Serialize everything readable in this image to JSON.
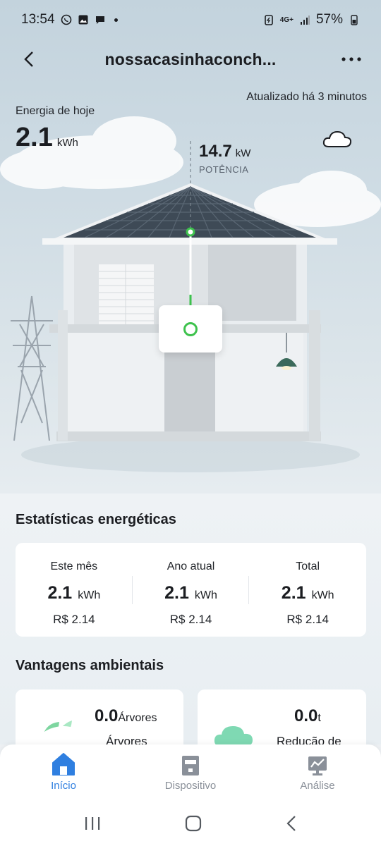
{
  "status_bar": {
    "time": "13:54",
    "network": "4G+",
    "battery": "57%"
  },
  "header": {
    "title": "nossacasinhaconch..."
  },
  "hero": {
    "updated_text": "Atualizado há 3 minutos",
    "energy_label": "Energia de hoje",
    "energy_value": "2.1",
    "energy_unit": "kWh",
    "power_value": "14.7",
    "power_unit": "kW",
    "power_label": "POTÊNCIA"
  },
  "stats": {
    "title": "Estatísticas energéticas",
    "columns": [
      {
        "label": "Este mês",
        "value": "2.1",
        "unit": "kWh",
        "money": "R$ 2.14"
      },
      {
        "label": "Ano atual",
        "value": "2.1",
        "unit": "kWh",
        "money": "R$ 2.14"
      },
      {
        "label": "Total",
        "value": "2.1",
        "unit": "kWh",
        "money": "R$ 2.14"
      }
    ]
  },
  "environment": {
    "title": "Vantagens ambientais",
    "cards": [
      {
        "value": "0.0",
        "unit": "Árvores",
        "label": "Árvores"
      },
      {
        "value": "0.0",
        "unit": "t",
        "label": "Redução de"
      }
    ]
  },
  "bottom_nav": {
    "items": [
      {
        "label": "Início",
        "active": true
      },
      {
        "label": "Dispositivo",
        "active": false
      },
      {
        "label": "Análise",
        "active": false
      }
    ]
  },
  "colors": {
    "accent": "#2f7fe0",
    "inactive": "#8a9099",
    "green": "#3ec24d"
  }
}
